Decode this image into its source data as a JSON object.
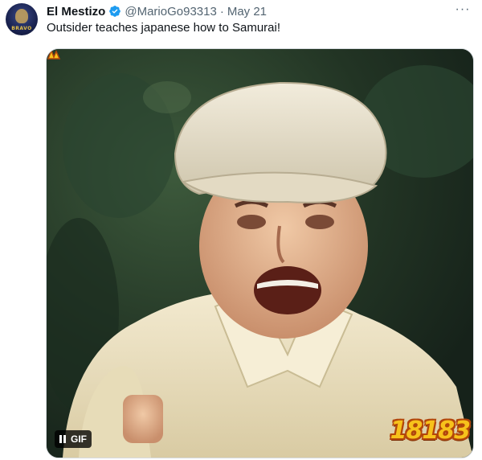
{
  "tweet": {
    "author_name": "El Mestizo",
    "handle": "@MarioGo93313",
    "separator": "·",
    "date": "May 21",
    "more_label": "···",
    "text": "Outsider teaches japanese how to Samurai!",
    "verified_icon": "verified-badge-icon",
    "verified_color": "#1d9bf0"
  },
  "media": {
    "type": "gif",
    "gif_label": "GIF",
    "pause_icon": "pause-icon",
    "description_colors": {
      "hat": "#e9e2cf",
      "shirt": "#efe4c2",
      "background": "#2f4330"
    }
  },
  "watermark": {
    "text": "18183"
  },
  "avatar": {
    "text": "BRAVO"
  }
}
